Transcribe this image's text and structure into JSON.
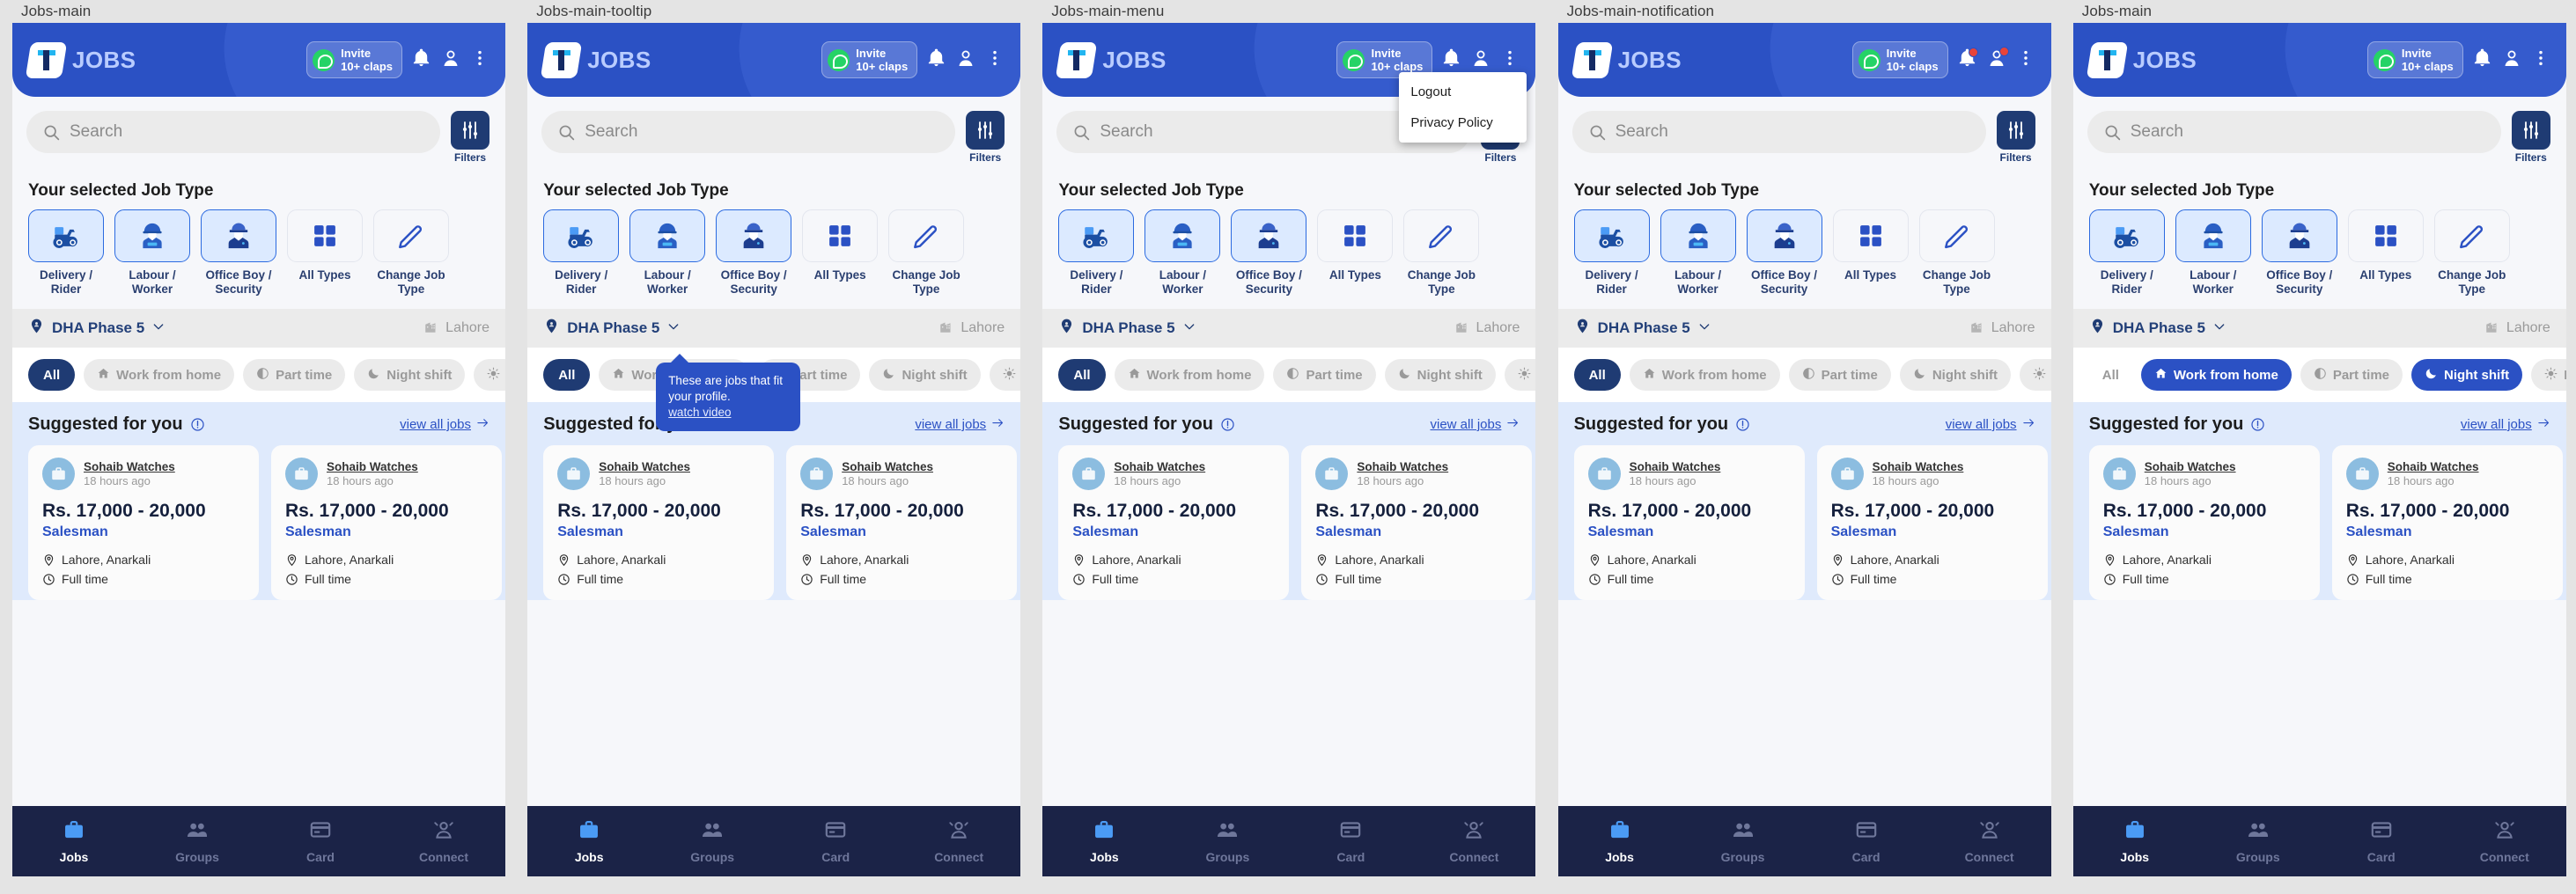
{
  "frames": [
    {
      "label": "Jobs-main",
      "variant": "main"
    },
    {
      "label": "Jobs-main-tooltip",
      "variant": "tooltip"
    },
    {
      "label": "Jobs-main-menu",
      "variant": "menu"
    },
    {
      "label": "Jobs-main-notification",
      "variant": "notification"
    },
    {
      "label": "Jobs-main",
      "variant": "chips"
    }
  ],
  "header": {
    "brand": "JOBS",
    "logo_icon": "jobs-logo-icon",
    "invite": {
      "line1": "Invite",
      "line2": "10+ claps",
      "icon": "whatsapp-icon"
    },
    "bell_icon": "bell-icon",
    "profile_icon": "profile-icon",
    "overflow_icon": "kebab-menu-icon"
  },
  "search": {
    "placeholder": "Search",
    "icon": "search-icon"
  },
  "filters": {
    "label": "Filters",
    "icon": "sliders-icon"
  },
  "job_type": {
    "title": "Your selected Job Type",
    "items": [
      {
        "label": "Delivery / Rider",
        "icon": "scooter-icon",
        "selected": true
      },
      {
        "label": "Labour / Worker",
        "icon": "worker-icon",
        "selected": true
      },
      {
        "label": "Office Boy / Security",
        "icon": "security-guard-icon",
        "selected": true
      },
      {
        "label": "All Types",
        "icon": "grid-icon",
        "selected": false
      },
      {
        "label": "Change Job Type",
        "icon": "pencil-icon",
        "selected": false
      }
    ]
  },
  "location": {
    "name": "DHA Phase 5",
    "chevron_icon": "chevron-down-icon",
    "pin_icon": "location-pin-icon",
    "city": "Lahore",
    "city_icon": "city-buildings-icon"
  },
  "chips": [
    {
      "label": "All",
      "icon": null,
      "state": "active"
    },
    {
      "label": "Work from home",
      "icon": "home-icon",
      "state": "default"
    },
    {
      "label": "Part time",
      "icon": "half-moon-icon",
      "state": "default"
    },
    {
      "label": "Night shift",
      "icon": "moon-icon",
      "state": "default"
    },
    {
      "label": "Full time",
      "icon": "sun-icon",
      "state": "default"
    }
  ],
  "suggested": {
    "title": "Suggested for you",
    "info_icon": "info-circle-icon",
    "view_all": "view all jobs",
    "view_all_icon": "arrow-right-icon",
    "cards": [
      {
        "company": "Sohaib Watches",
        "posted": "18 hours ago",
        "avatar_icon": "briefcase-icon",
        "salary": "Rs. 17,000 - 20,000",
        "role": "Salesman",
        "location": "Lahore, Anarkali",
        "location_icon": "map-pin-icon",
        "job_time": "Full time",
        "job_time_icon": "clock-icon"
      },
      {
        "company": "Sohaib Watches",
        "posted": "18 hours ago",
        "avatar_icon": "briefcase-icon",
        "salary": "Rs. 17,000 - 20,000",
        "role": "Salesman",
        "location": "Lahore, Anarkali",
        "location_icon": "map-pin-icon",
        "job_time": "Full time",
        "job_time_icon": "clock-icon"
      }
    ]
  },
  "bottom_nav": [
    {
      "label": "Jobs",
      "icon": "briefcase-icon",
      "active": true
    },
    {
      "label": "Groups",
      "icon": "people-icon",
      "active": false
    },
    {
      "label": "Card",
      "icon": "card-icon",
      "active": false
    },
    {
      "label": "Connect",
      "icon": "connect-icon",
      "active": false
    }
  ],
  "tooltip": {
    "text": "These are jobs that fit your profile.",
    "link": "watch video"
  },
  "menu": {
    "items": [
      {
        "label": "Logout"
      },
      {
        "label": "Privacy Policy"
      }
    ]
  }
}
